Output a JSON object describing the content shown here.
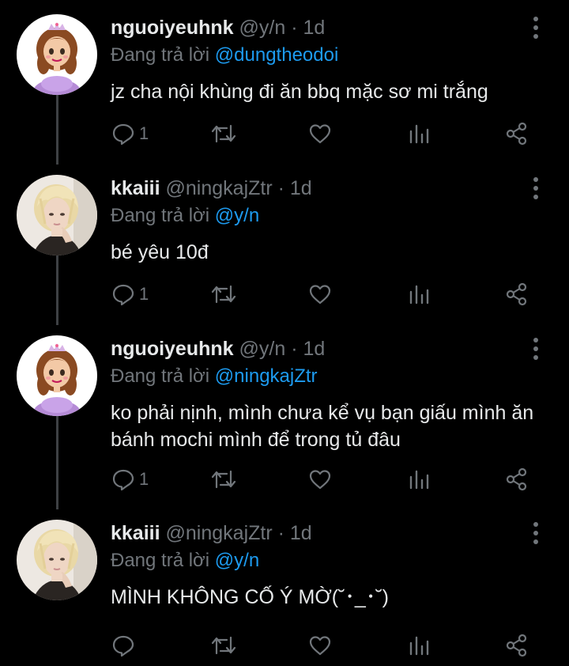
{
  "colors": {
    "background": "#000000",
    "text": "#e7e9ea",
    "muted": "#71767b",
    "mention": "#1d9bf0",
    "thread_line": "#3e4144"
  },
  "tweets": [
    {
      "name": "nguoiyeuhnk",
      "handle": "@y/n",
      "time": "· 1d",
      "replying_prefix": "Đang trả lời",
      "replying_to": "@dungtheodoi",
      "text": "jz cha nội khùng đi ăn bbq mặc sơ mi trắng",
      "reply_count": "1",
      "avatar": "princess-avatar"
    },
    {
      "name": "kkaiii",
      "handle": "@ningkajZtr",
      "time": "· 1d",
      "replying_prefix": "Đang trả lời",
      "replying_to": "@y/n",
      "text": "bé yêu 10đ",
      "reply_count": "1",
      "avatar": "blonde-person-avatar"
    },
    {
      "name": "nguoiyeuhnk",
      "handle": "@y/n",
      "time": "· 1d",
      "replying_prefix": "Đang trả lời",
      "replying_to": "@ningkajZtr",
      "text": "ko phải nịnh, mình chưa kể vụ bạn giấu mình ăn bánh mochi mình để trong tủ đâu",
      "reply_count": "1",
      "avatar": "princess-avatar"
    },
    {
      "name": "kkaiii",
      "handle": "@ningkajZtr",
      "time": "· 1d",
      "replying_prefix": "Đang trả lời",
      "replying_to": "@y/n",
      "text": "MÌNH KHÔNG CỐ Ý MỜ(˘･_･˘)",
      "reply_count": "",
      "avatar": "blonde-person-avatar"
    }
  ]
}
